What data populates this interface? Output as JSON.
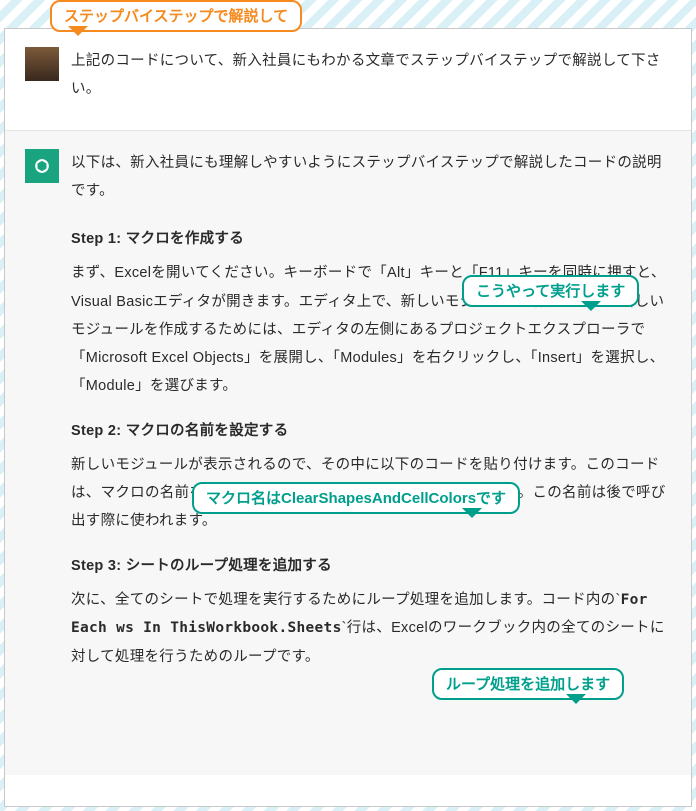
{
  "callouts": [
    {
      "text": "ステップバイステップで解説して",
      "color": "orange",
      "tail": "bl"
    },
    {
      "text": "こうやって実行します",
      "color": "teal",
      "tail": "br"
    },
    {
      "text": "マクロ名はClearShapesAndCellColorsです",
      "color": "teal",
      "tail": "br"
    },
    {
      "text": "ループ処理を追加します",
      "color": "teal",
      "tail": "br"
    }
  ],
  "user_message": "上記のコードについて、新入社員にもわかる文章でステップバイステップで解説して下さい。",
  "assistant_intro": "以下は、新入社員にも理解しやすいようにステップバイステップで解説したコードの説明です。",
  "steps": [
    {
      "heading": "Step 1: マクロを作成する",
      "body": "まず、Excelを開いてください。キーボードで「Alt」キーと「F11」キーを同時に押すと、Visual Basicエディタが開きます。エディタ上で、新しいモジュールを作成します。新しいモジュールを作成するためには、エディタの左側にあるプロジェクトエクスプローラで「Microsoft Excel Objects」を展開し、「Modules」を右クリックし、「Insert」を選択し、「Module」を選びます。"
    },
    {
      "heading": "Step 2: マクロの名前を設定する",
      "body_before": "新しいモジュールが表示されるので、その中に以下のコードを貼り付けます。このコードは、マクロの名前を`",
      "code": "ClearShapesAndCellColors",
      "body_after": "`としています。この名前は後で呼び出す際に使われます。"
    },
    {
      "heading": "Step 3: シートのループ処理を追加する",
      "body_before": "次に、全てのシートで処理を実行するためにループ処理を追加します。コード内の`",
      "code": "For Each ws In ThisWorkbook.Sheets",
      "body_after": "`行は、Excelのワークブック内の全てのシートに対して処理を行うためのループです。"
    }
  ],
  "icons": {
    "ai": "knot-icon"
  }
}
